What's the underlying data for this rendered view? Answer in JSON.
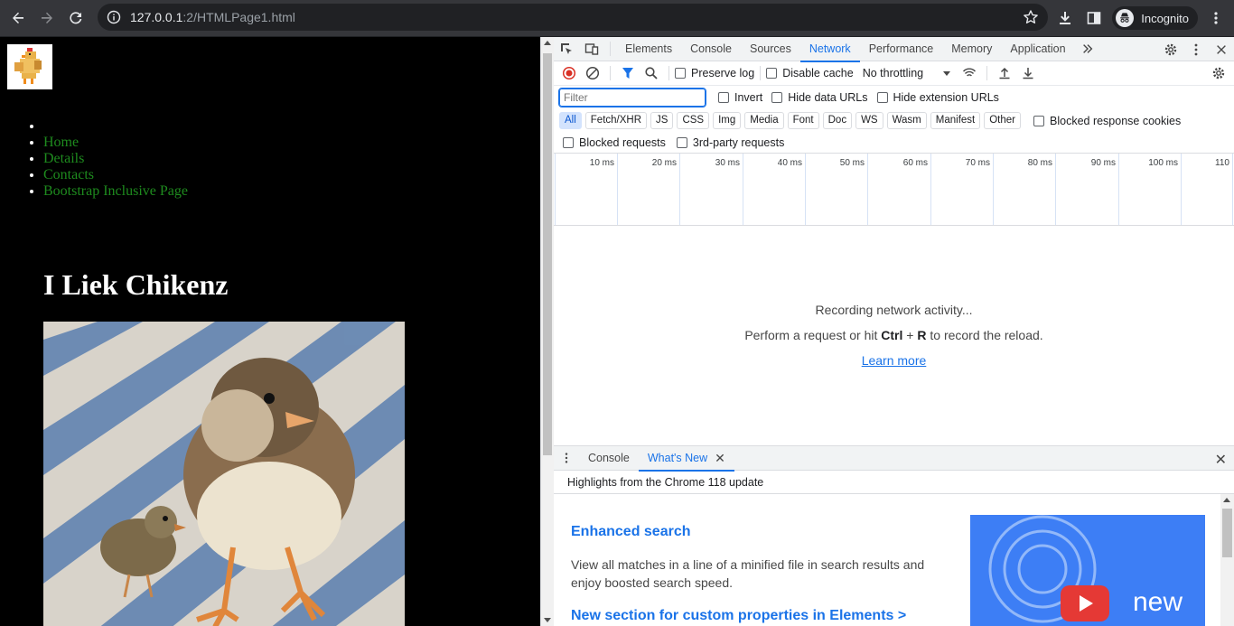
{
  "browser": {
    "url_host": "127.0.0.1",
    "url_path": ":2/HTMLPage1.html",
    "incognito_label": "Incognito"
  },
  "page": {
    "nav_items": [
      "",
      "Home",
      "Details",
      "Contacts",
      "Bootstrap Inclusive Page"
    ],
    "heading": "I Liek Chikenz"
  },
  "devtools": {
    "tabs": [
      "Elements",
      "Console",
      "Sources",
      "Network",
      "Performance",
      "Memory",
      "Application"
    ],
    "active_tab": "Network",
    "toolbar": {
      "preserve_log": "Preserve log",
      "disable_cache": "Disable cache",
      "throttling": "No throttling"
    },
    "filter": {
      "placeholder": "Filter",
      "invert": "Invert",
      "hide_data_urls": "Hide data URLs",
      "hide_extension_urls": "Hide extension URLs"
    },
    "types": [
      "All",
      "Fetch/XHR",
      "JS",
      "CSS",
      "Img",
      "Media",
      "Font",
      "Doc",
      "WS",
      "Wasm",
      "Manifest",
      "Other"
    ],
    "blocked_response_cookies": "Blocked response cookies",
    "blocked_requests": "Blocked requests",
    "third_party_requests": "3rd-party requests",
    "timeline_ticks": [
      "10 ms",
      "20 ms",
      "30 ms",
      "40 ms",
      "50 ms",
      "60 ms",
      "70 ms",
      "80 ms",
      "90 ms",
      "100 ms",
      "110"
    ],
    "empty": {
      "line1": "Recording network activity...",
      "line2_pre": "Perform a request or hit ",
      "line2_key1": "Ctrl",
      "line2_plus": " + ",
      "line2_key2": "R",
      "line2_post": " to record the reload.",
      "learn_more": "Learn more"
    },
    "drawer": {
      "tabs": [
        "Console",
        "What's New"
      ],
      "highlights": "Highlights from the Chrome 118 update",
      "item1_title": "Enhanced search",
      "item1_desc": "View all matches in a line of a minified file in search results and enjoy boosted search speed.",
      "item2_title": "New section for custom properties in Elements >",
      "image_badge": "new"
    }
  },
  "colors": {
    "accent": "#1a73e8",
    "link_green": "#1e8b1e",
    "record_red": "#d93025"
  }
}
